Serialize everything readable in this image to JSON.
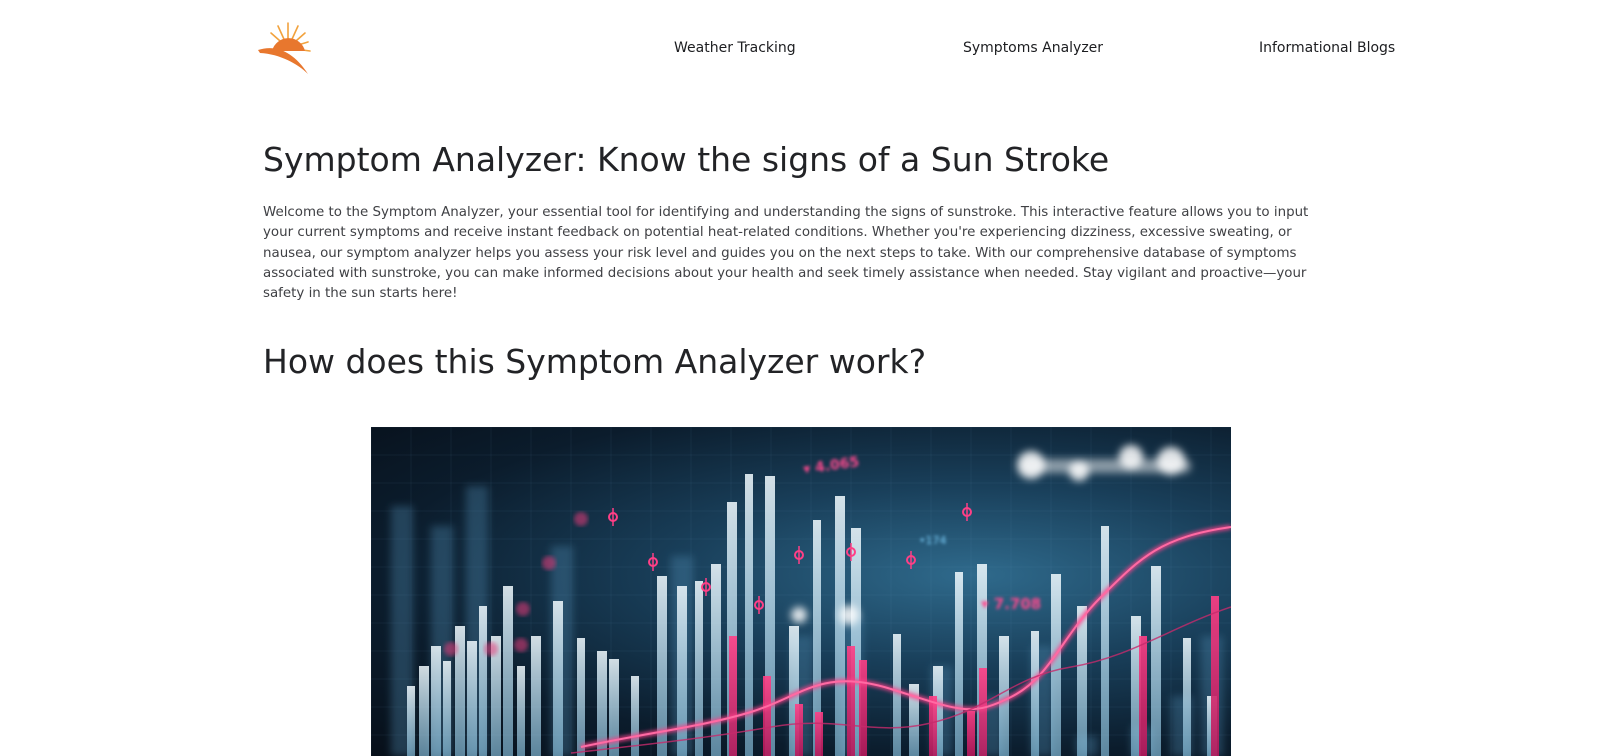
{
  "header": {
    "logo_icon": "sun-icon",
    "logo_colors": {
      "primary": "#e8772e",
      "secondary": "#f2a23d"
    },
    "nav": [
      {
        "label": "Weather Tracking"
      },
      {
        "label": "Symptoms Analyzer"
      },
      {
        "label": "Informational Blogs"
      }
    ]
  },
  "main": {
    "title": "Symptom Analyzer: Know the signs of a Sun Stroke",
    "intro": "Welcome to the Symptom Analyzer, your essential tool for identifying and understanding the signs of sunstroke. This interactive feature allows you to input your current symptoms and receive instant feedback on potential heat-related conditions. Whether you're experiencing dizziness, excessive sweating, or nausea, our symptom analyzer helps you assess your risk level and guides you on the next steps to take. With our comprehensive database of symptoms associated with sunstroke, you can make informed decisions about your health and seek timely assistance when needed. Stay vigilant and proactive—your safety in the sun starts here!",
    "section_heading": "How does this Symptom Analyzer work?",
    "hero_image": {
      "labels": [
        "▾ 4.065",
        "▾ 7.708",
        "•174"
      ],
      "accent_color": "#f0357a",
      "bar_color": "#dff1fb"
    }
  }
}
